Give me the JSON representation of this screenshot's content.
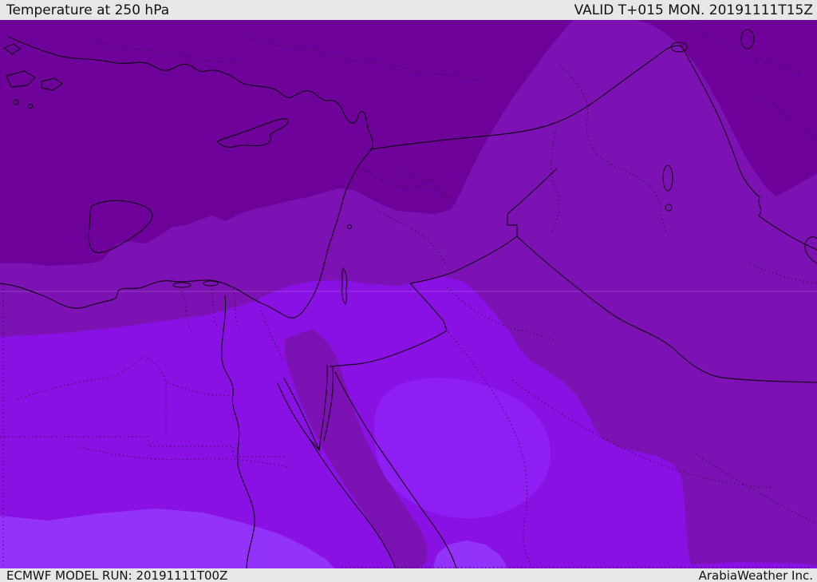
{
  "header": {
    "title": "Temperature at 250 hPa",
    "validity": "VALID T+015 MON. 20191111T15Z"
  },
  "footer": {
    "model_run": "ECMWF MODEL RUN: 20191111T00Z",
    "credit": "ArabiaWeather Inc."
  },
  "map": {
    "kind": "filled contour temperature map",
    "bands_cold_to_warm": [
      {
        "name": "coldest-north-band",
        "color": "#6E0199"
      },
      {
        "name": "cold-mid-band",
        "color": "#7D12B4"
      },
      {
        "name": "warm-band",
        "color": "#8A11E4"
      },
      {
        "name": "warm-core-blob",
        "color": "#8F1EF4"
      },
      {
        "name": "warmest-south-band",
        "color": "#9232FA"
      }
    ]
  },
  "colors": {
    "band_a_coldest": "#6E0199",
    "band_b": "#7D12B4",
    "band_d": "#8A11E4",
    "band_d_core": "#8F1EF4",
    "band_e_warmest": "#9232FA",
    "line_solid": "#190420",
    "line_dotted": "#2B0A33",
    "gridline": "rgba(255,255,255,0.17)",
    "bar_bg": "#E7E7E7",
    "bar_text": "#111111"
  }
}
